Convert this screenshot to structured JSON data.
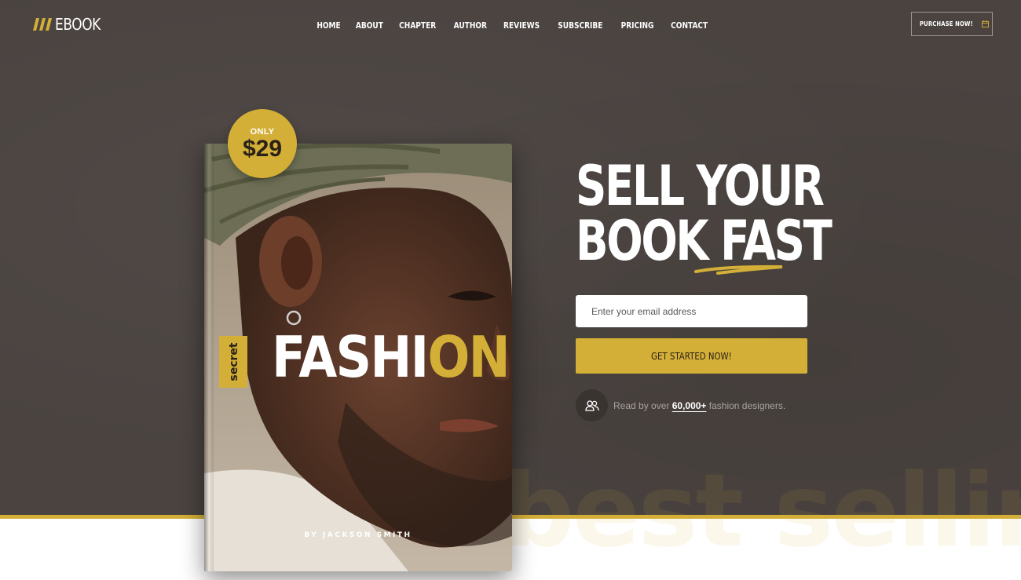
{
  "brand": {
    "name": "EBOOK",
    "accent": "#d4af37",
    "background": "#4a4340"
  },
  "nav": {
    "items": [
      "HOME",
      "ABOUT",
      "CHAPTER",
      "AUTHOR",
      "REVIEWS",
      "SUBSCRIBE",
      "PRICING",
      "CONTACT"
    ]
  },
  "header": {
    "purchase_label": "PURCHASE NOW!",
    "purchase_icon": "calendar-icon"
  },
  "book": {
    "price_prefix": "ONLY",
    "price": "$29",
    "ribbon": "secret",
    "title_main": "FASHI",
    "title_accent": "ON",
    "author": "BY JACKSON SMITH"
  },
  "hero": {
    "headline_line1": "SELL YOUR",
    "headline_line2": "BOOK FAST",
    "email_placeholder": "Enter your email address",
    "cta_label": "GET STARTED NOW!",
    "readers_prefix": "Read by over ",
    "readers_count": "60,000+",
    "readers_suffix": " fashion designers.",
    "readers_icon": "users-icon"
  },
  "background_text": "best selling bo"
}
